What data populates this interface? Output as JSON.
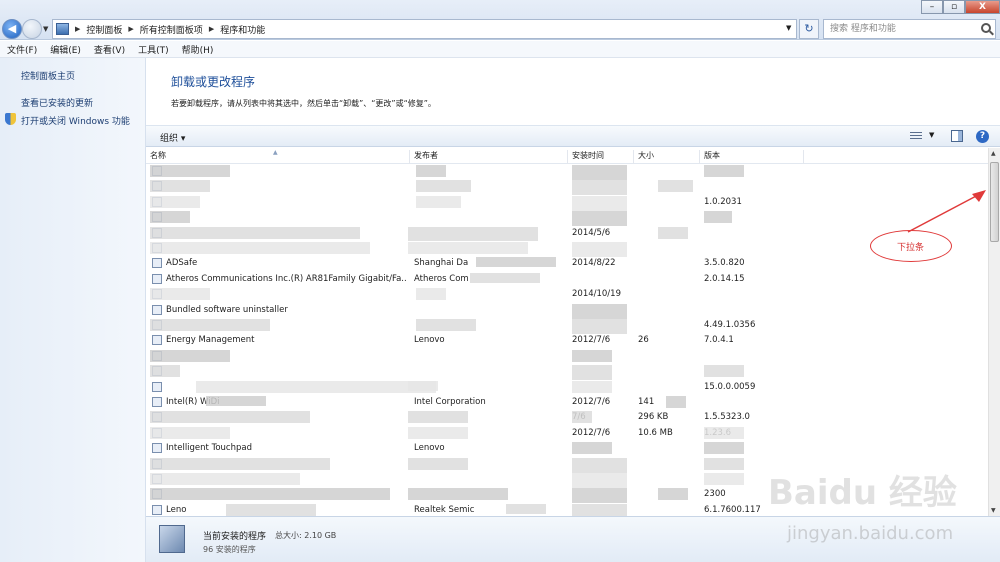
{
  "window": {
    "address": [
      "控制面板",
      "所有控制面板项",
      "程序和功能"
    ],
    "search_placeholder": "搜索 程序和功能",
    "min": "–",
    "max": "▫",
    "close": "X"
  },
  "menu": [
    "文件(F)",
    "编辑(E)",
    "查看(V)",
    "工具(T)",
    "帮助(H)"
  ],
  "sidebar": {
    "items": [
      "控制面板主页",
      "查看已安装的更新",
      "打开或关闭 Windows 功能"
    ]
  },
  "main": {
    "title": "卸载或更改程序",
    "description": "若要卸载程序，请从列表中将其选中，然后单击“卸载”、“更改”或“修复”。"
  },
  "toolbar": {
    "organize": "组织 ▾"
  },
  "columns": [
    "名称",
    "发布者",
    "安装时间",
    "大小",
    "版本"
  ],
  "rows": [
    {
      "name": "",
      "publisher": "",
      "date": "",
      "size": "",
      "version": ""
    },
    {
      "name": "",
      "publisher": "",
      "date": "",
      "size": "",
      "version": ""
    },
    {
      "name": "",
      "publisher": "",
      "date": "",
      "size": "",
      "version": "1.0.2031"
    },
    {
      "name": "",
      "publisher": "",
      "date": "",
      "size": "",
      "version": ""
    },
    {
      "name": "",
      "publisher": "",
      "date": "2014/5/6",
      "size": "",
      "version": ""
    },
    {
      "name": "",
      "publisher": "",
      "date": "",
      "size": "",
      "version": ""
    },
    {
      "name": "ADSafe",
      "publisher": "Shanghai Da",
      "date": "2014/8/22",
      "size": "",
      "version": "3.5.0.820"
    },
    {
      "name": "Atheros Communications Inc.(R) AR81Family Gigabit/Fa...",
      "publisher": "Atheros Com",
      "date": "",
      "size": "",
      "version": "2.0.14.15"
    },
    {
      "name": "",
      "publisher": "",
      "date": "2014/10/19",
      "size": "",
      "version": ""
    },
    {
      "name": "Bundled software uninstaller",
      "publisher": "",
      "date": "",
      "size": "",
      "version": ""
    },
    {
      "name": "",
      "publisher": "",
      "date": "",
      "size": "",
      "version": "4.49.1.0356"
    },
    {
      "name": "Energy Management",
      "publisher": "Lenovo",
      "date": "2012/7/6",
      "size": "26",
      "version": "7.0.4.1"
    },
    {
      "name": "",
      "publisher": "",
      "date": "",
      "size": "",
      "version": ""
    },
    {
      "name": "",
      "publisher": "",
      "date": "",
      "size": "",
      "version": ""
    },
    {
      "name": "",
      "publisher": "",
      "date": "",
      "size": "",
      "version": "15.0.0.0059"
    },
    {
      "name": "Intel(R) WiDi",
      "publisher": "Intel Corporation",
      "date": "2012/7/6",
      "size": "141",
      "version": ""
    },
    {
      "name": "",
      "publisher": "",
      "date": "7/6",
      "size": "296 KB",
      "version": "1.5.5323.0"
    },
    {
      "name": "",
      "publisher": "",
      "date": "2012/7/6",
      "size": "10.6 MB",
      "version": "1.23.6"
    },
    {
      "name": "Intelligent Touchpad",
      "publisher": "Lenovo",
      "date": "",
      "size": "",
      "version": ""
    },
    {
      "name": "",
      "publisher": "",
      "date": "",
      "size": "",
      "version": ""
    },
    {
      "name": "",
      "publisher": "",
      "date": "",
      "size": "",
      "version": ""
    },
    {
      "name": "",
      "publisher": "",
      "date": "",
      "size": "",
      "version": "2300"
    },
    {
      "name": "Leno",
      "publisher": "Realtek Semic",
      "date": "",
      "size": "",
      "version": "6.1.7600.117"
    }
  ],
  "annotation": {
    "label": "下拉条"
  },
  "status": {
    "title": "当前安装的程序",
    "total_size": "总大小: 2.10 GB",
    "count": "96 安装的程序"
  },
  "watermark": {
    "logo": "Baidu 经验",
    "url": "jingyan.baidu.com"
  }
}
